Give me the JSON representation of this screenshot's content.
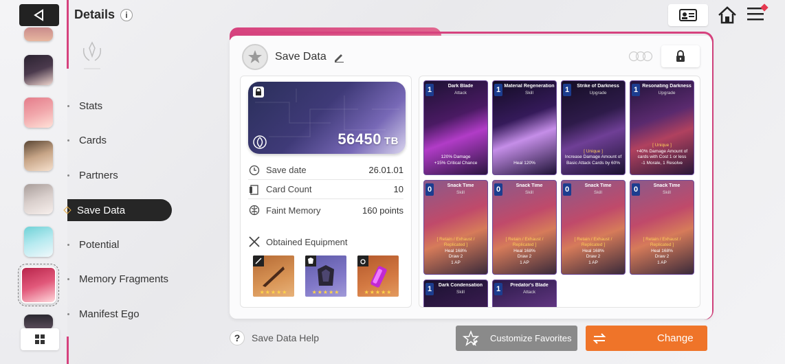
{
  "header": {
    "title": "Details",
    "info_icon": "i"
  },
  "nav": {
    "items": [
      {
        "label": "Stats"
      },
      {
        "label": "Cards"
      },
      {
        "label": "Partners"
      },
      {
        "label": "Save Data",
        "active": true
      },
      {
        "label": "Potential"
      },
      {
        "label": "Memory Fragments"
      },
      {
        "label": "Manifest Ego"
      }
    ]
  },
  "panel": {
    "title": "Save Data",
    "tb_value": "56450",
    "tb_unit": "TB",
    "info_rows": [
      {
        "label": "Save date",
        "value": "26.01.01",
        "icon": "clock-icon"
      },
      {
        "label": "Card Count",
        "value": "10",
        "icon": "card-icon"
      },
      {
        "label": "Faint Memory",
        "value": "160 points",
        "icon": "memory-icon"
      }
    ],
    "equipment_title": "Obtained Equipment",
    "equipment": [
      {
        "icon": "sword-icon",
        "stars": "★★★★★"
      },
      {
        "icon": "armor-icon",
        "stars": "★★★★★"
      },
      {
        "icon": "ring-icon",
        "stars": "★★★★★"
      }
    ]
  },
  "cards": [
    {
      "cost": "1",
      "name": "Dark Blade",
      "type": "Attack",
      "tag": "",
      "desc": "120% Damage\n+15% Critical Chance"
    },
    {
      "cost": "1",
      "name": "Material Regeneration",
      "type": "Skill",
      "tag": "",
      "desc": "Heal 120%"
    },
    {
      "cost": "1",
      "name": "Strike of Darkness",
      "type": "Upgrade",
      "tag": "[ Unique ]",
      "desc": "Increase Damage Amount of Basic Attack Cards by 60%"
    },
    {
      "cost": "1",
      "name": "Resonating Darkness",
      "type": "Upgrade",
      "tag": "[ Unique ]",
      "desc": "+40% Damage Amount of cards with Cost 1 or less\n-1 Morale, 1 Resolve"
    },
    {
      "cost": "0",
      "name": "Snack Time",
      "type": "Skill",
      "tag": "[ Retain / Exhaust / Replicated ]",
      "desc": "Heal 168%\nDraw 2\n1 AP"
    },
    {
      "cost": "0",
      "name": "Snack Time",
      "type": "Skill",
      "tag": "[ Retain / Exhaust / Replicated ]",
      "desc": "Heal 168%\nDraw 2\n1 AP"
    },
    {
      "cost": "0",
      "name": "Snack Time",
      "type": "Skill",
      "tag": "[ Retain / Exhaust / Replicated ]",
      "desc": "Heal 168%\nDraw 2\n1 AP"
    },
    {
      "cost": "0",
      "name": "Snack Time",
      "type": "Skill",
      "tag": "[ Retain / Exhaust / Replicated ]",
      "desc": "Heal 168%\nDraw 2\n1 AP"
    },
    {
      "cost": "1",
      "name": "Dark Condensation",
      "type": "Skill",
      "tag": "",
      "desc": ""
    },
    {
      "cost": "1",
      "name": "Predator's Blade",
      "type": "Attack",
      "tag": "",
      "desc": ""
    }
  ],
  "footer": {
    "help_label": "Save Data Help",
    "favorites_label": "Customize Favorites",
    "change_label": "Change"
  },
  "colors": {
    "accent_pink": "#d6427e",
    "change_orange": "#ef7429",
    "favorites_gray": "#8a8a8a"
  }
}
